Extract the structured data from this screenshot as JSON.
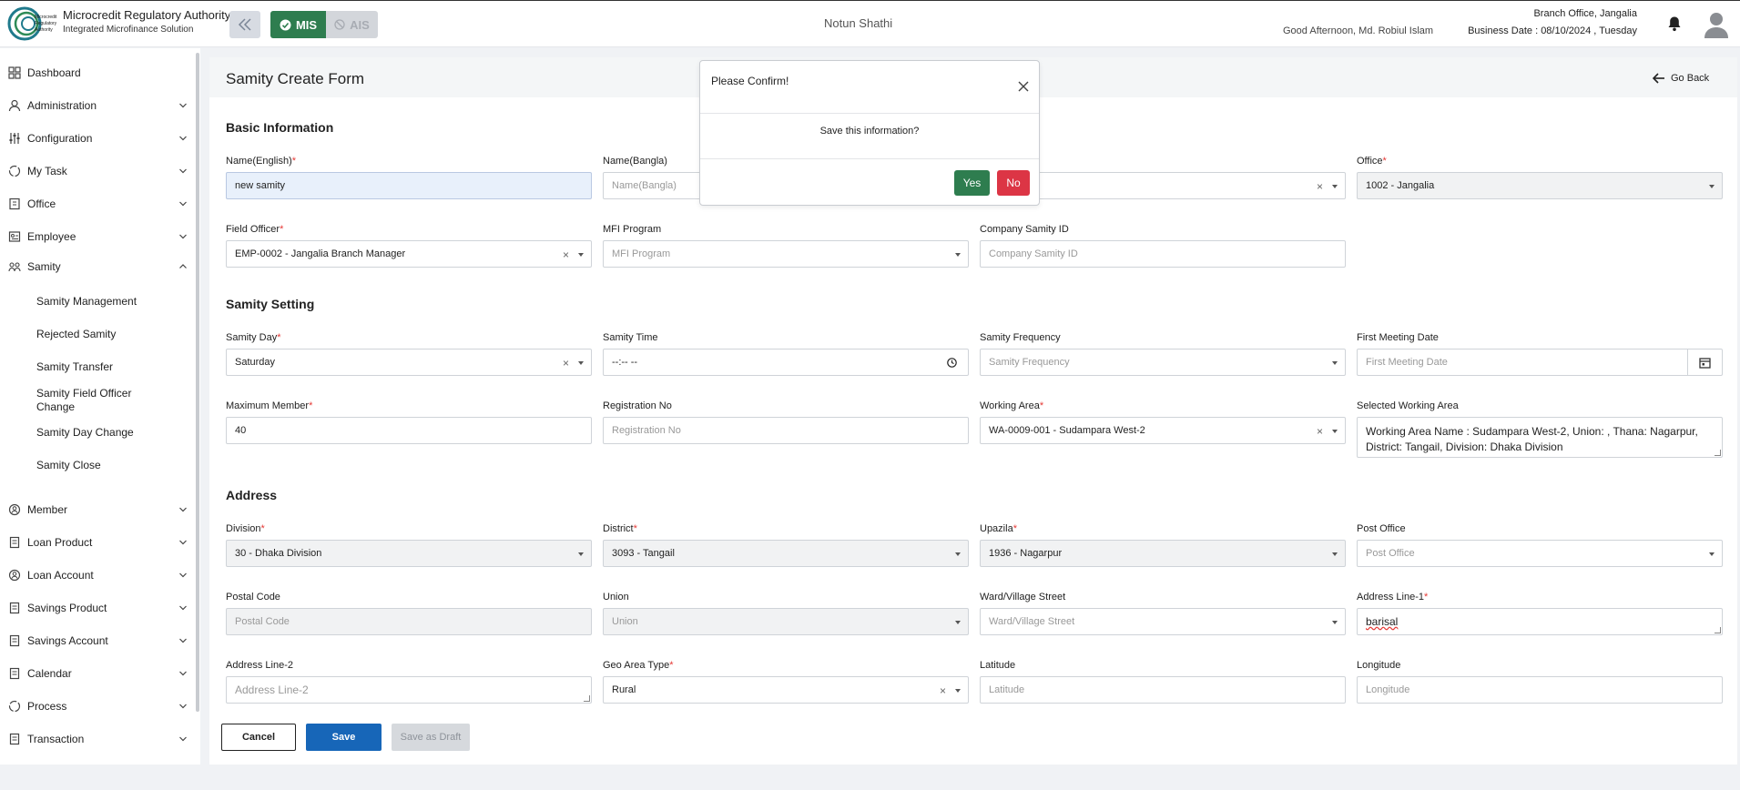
{
  "header": {
    "brand_title": "Microcredit Regulatory Authority",
    "brand_sub": "Integrated Microfinance Solution",
    "logo_text": "Microcredit Regulatory Authority",
    "mode_mis": "MIS",
    "mode_ais": "AIS",
    "app_name": "Notun Shathi",
    "greeting": "Good Afternoon, Md. Robiul Islam",
    "branch": "Branch Office, Jangalia",
    "business_date": "Business Date : 08/10/2024 , Tuesday"
  },
  "sidebar": {
    "items": [
      {
        "label": "Dashboard",
        "icon": "dashboard-icon"
      },
      {
        "label": "Administration",
        "icon": "admin-icon"
      },
      {
        "label": "Configuration",
        "icon": "sliders-icon"
      },
      {
        "label": "My Task",
        "icon": "task-icon"
      },
      {
        "label": "Office",
        "icon": "building-icon"
      },
      {
        "label": "Employee",
        "icon": "id-card-icon"
      },
      {
        "label": "Samity",
        "icon": "group-icon"
      },
      {
        "label": "Member",
        "icon": "people-icon"
      },
      {
        "label": "Loan Product",
        "icon": "document-icon"
      },
      {
        "label": "Loan Account",
        "icon": "people-icon"
      },
      {
        "label": "Savings Product",
        "icon": "document-icon"
      },
      {
        "label": "Savings Account",
        "icon": "document-icon"
      },
      {
        "label": "Calendar",
        "icon": "document-icon"
      },
      {
        "label": "Process",
        "icon": "process-icon"
      },
      {
        "label": "Transaction",
        "icon": "document-icon"
      }
    ],
    "samity_sub": [
      "Samity Management",
      "Rejected Samity",
      "Samity Transfer",
      "Samity Field Officer Change",
      "Samity Day Change",
      "Samity Close"
    ]
  },
  "main": {
    "page_title": "Samity Create Form",
    "go_back": "Go Back",
    "sections": {
      "basic": "Basic Information",
      "setting": "Samity Setting",
      "address": "Address"
    },
    "fields": {
      "name_en": {
        "label": "Name(English)",
        "value": "new samity"
      },
      "name_bn": {
        "label": "Name(Bangla)",
        "placeholder": "Name(Bangla)"
      },
      "office": {
        "label": "Office",
        "value": "1002 - Jangalia"
      },
      "field_officer": {
        "label": "Field Officer",
        "value": "EMP-0002 - Jangalia Branch Manager"
      },
      "mfi_program": {
        "label": "MFI Program",
        "placeholder": "MFI Program"
      },
      "company_samity_id": {
        "label": "Company Samity ID",
        "placeholder": "Company Samity ID"
      },
      "samity_day": {
        "label": "Samity Day",
        "value": "Saturday"
      },
      "samity_time": {
        "label": "Samity Time",
        "value": "--:-- --"
      },
      "samity_frequency": {
        "label": "Samity Frequency",
        "placeholder": "Samity Frequency"
      },
      "first_meeting_date": {
        "label": "First Meeting Date",
        "placeholder": "First Meeting Date"
      },
      "max_member": {
        "label": "Maximum Member",
        "value": "40"
      },
      "registration_no": {
        "label": "Registration No",
        "placeholder": "Registration No"
      },
      "working_area": {
        "label": "Working Area",
        "value": "WA-0009-001 - Sudampara West-2"
      },
      "selected_working_area": {
        "label": "Selected Working Area",
        "value": "Working Area Name : Sudampara West-2, Union: , Thana:  Nagarpur, District: Tangail, Division: Dhaka Division"
      },
      "division": {
        "label": "Division",
        "value": "30 - Dhaka Division"
      },
      "district": {
        "label": "District",
        "value": "3093 - Tangail"
      },
      "upazila": {
        "label": "Upazila",
        "value": "1936 - Nagarpur"
      },
      "post_office": {
        "label": "Post Office",
        "placeholder": "Post Office"
      },
      "postal_code": {
        "label": "Postal Code",
        "placeholder": "Postal Code"
      },
      "union": {
        "label": "Union",
        "placeholder": "Union"
      },
      "ward_village": {
        "label": "Ward/Village Street",
        "placeholder": "Ward/Village Street"
      },
      "address_line1": {
        "label": "Address Line-1",
        "value": "barisal"
      },
      "address_line2": {
        "label": "Address Line-2",
        "placeholder": "Address Line-2"
      },
      "geo_area_type": {
        "label": "Geo Area Type",
        "value": "Rural"
      },
      "latitude": {
        "label": "Latitude",
        "placeholder": "Latitude"
      },
      "longitude": {
        "label": "Longitude",
        "placeholder": "Longitude"
      }
    }
  },
  "footer": {
    "cancel": "Cancel",
    "save": "Save",
    "save_draft": "Save as Draft"
  },
  "modal": {
    "title": "Please Confirm!",
    "message": "Save this information?",
    "yes": "Yes",
    "no": "No"
  },
  "colors": {
    "primary": "#1766b8",
    "success": "#2e7d4f",
    "danger": "#dc3545"
  }
}
